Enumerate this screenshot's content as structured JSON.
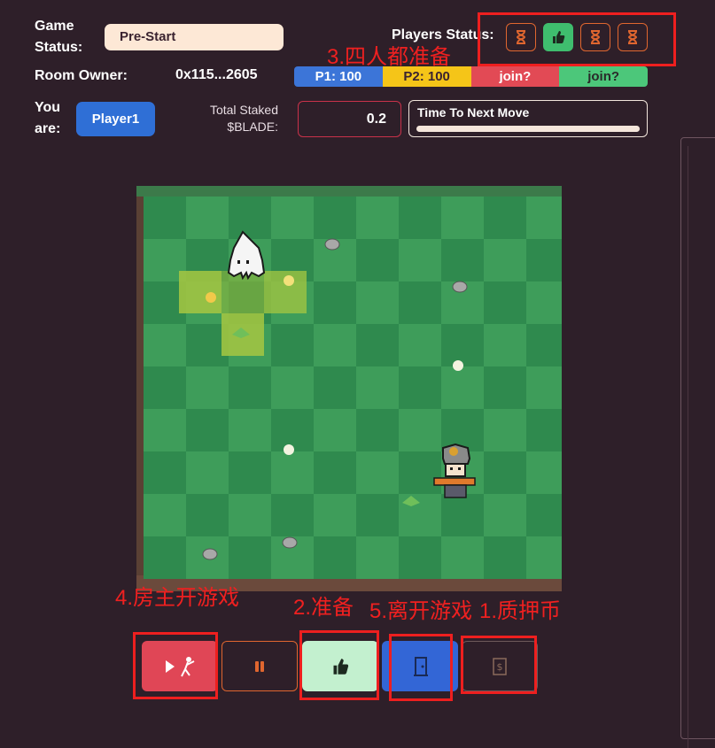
{
  "game_status": {
    "label_line1": "Game",
    "label_line2": "Status:",
    "value": "Pre-Start"
  },
  "room_owner": {
    "label": "Room Owner:",
    "value": "0x115...2605"
  },
  "players_hp": [
    "P1: 100",
    "P2: 100",
    "join?",
    "join?"
  ],
  "you_are": {
    "label_line1": "You",
    "label_line2": "are:",
    "value": "Player1"
  },
  "staked": {
    "label_line1": "Total Staked",
    "label_line2": "$BLADE:",
    "value": "0.2"
  },
  "timer": {
    "title": "Time To Next Move",
    "progress": 1.0
  },
  "players_status": {
    "label": "Players Status:",
    "icons": [
      "hourglass-icon",
      "thumbs-up-icon",
      "hourglass-icon",
      "hourglass-icon"
    ]
  },
  "annotations": {
    "four_ready": "3.四人都准备",
    "owner_start": "4.房主开游戏",
    "ready": "2.准备",
    "leave": "5.离开游戏",
    "stake": "1.质押币"
  },
  "controls": [
    "play-fight-button",
    "pause-button",
    "ready-button",
    "leave-button",
    "stake-button"
  ],
  "colors": {
    "background": "#2e1f29",
    "status_pill": "#fde8d6",
    "p1": "#3c75d8",
    "p2": "#f5c518",
    "p3": "#e24a55",
    "p4": "#4cc77a",
    "annotation": "#ef2020"
  }
}
